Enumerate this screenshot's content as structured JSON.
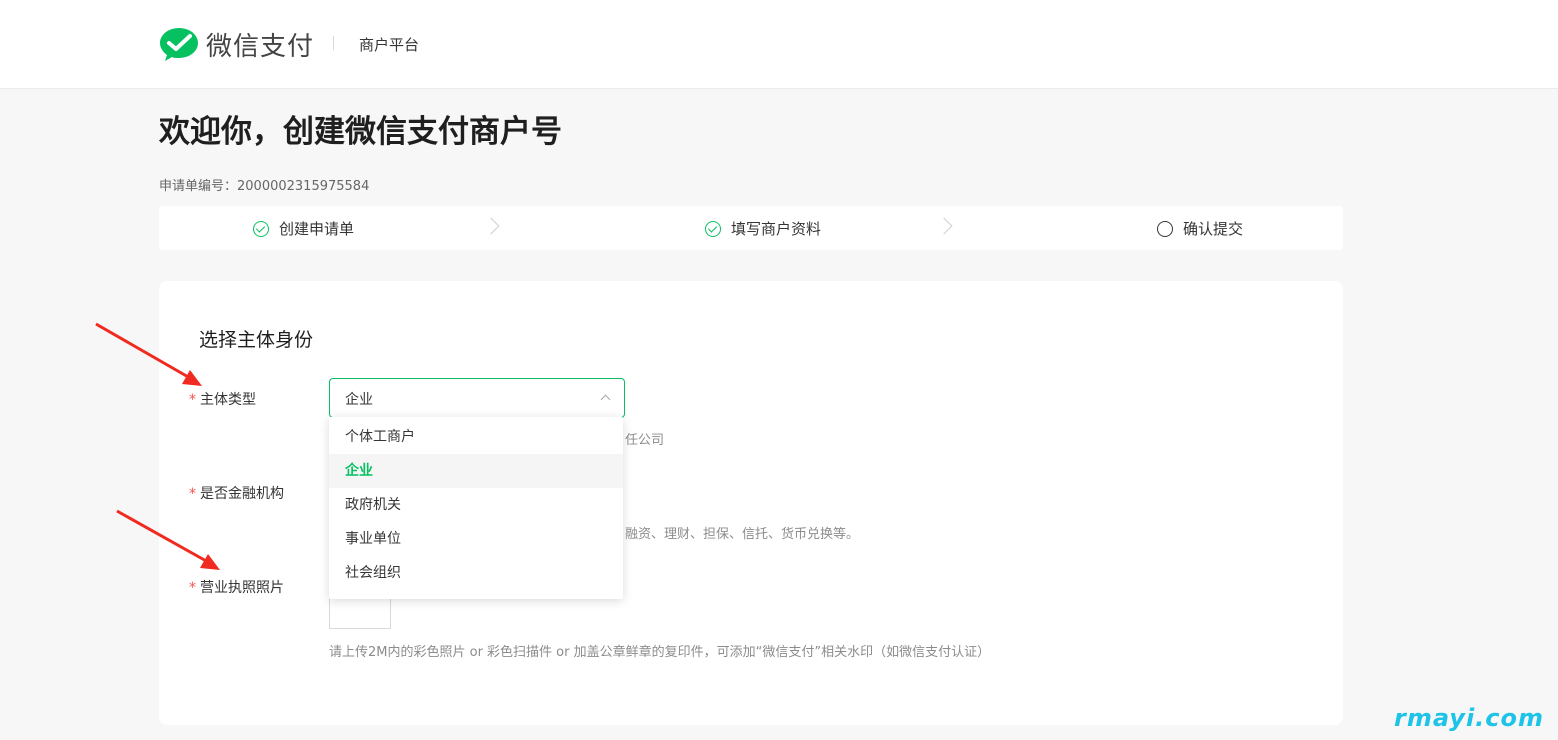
{
  "header": {
    "brand": "微信支付",
    "platform": "商户平台",
    "brand_color": "#07c160"
  },
  "page": {
    "title": "欢迎你，创建微信支付商户号",
    "order_label": "申请单编号：2000002315975584"
  },
  "steps": [
    {
      "label": "创建申请单",
      "state": "done",
      "icon": "check-circle-icon"
    },
    {
      "label": "填写商户资料",
      "state": "done",
      "icon": "check-circle-icon"
    },
    {
      "label": "确认提交",
      "state": "todo",
      "icon": "circle-icon"
    }
  ],
  "form": {
    "section_title": "选择主体身份",
    "required_mark": "*",
    "subject_type": {
      "label": "主体类型",
      "value": "企业",
      "options": [
        "个体工商户",
        "企业",
        "政府机关",
        "事业单位",
        "社会组织"
      ],
      "selected_index": 1,
      "hint_partial": "任公司"
    },
    "financial": {
      "label": "是否金融机构",
      "hint_partial": "融资、理财、担保、信托、货币兑换等。"
    },
    "license": {
      "label": "营业执照照片",
      "hint": "请上传2M内的彩色照片 or 彩色扫描件 or 加盖公章鲜章的复印件，可添加“微信支付”相关水印（如微信支付认证）"
    }
  },
  "annotations": {
    "arrow_color": "#f02a1f"
  },
  "watermark": "rmayi.com"
}
